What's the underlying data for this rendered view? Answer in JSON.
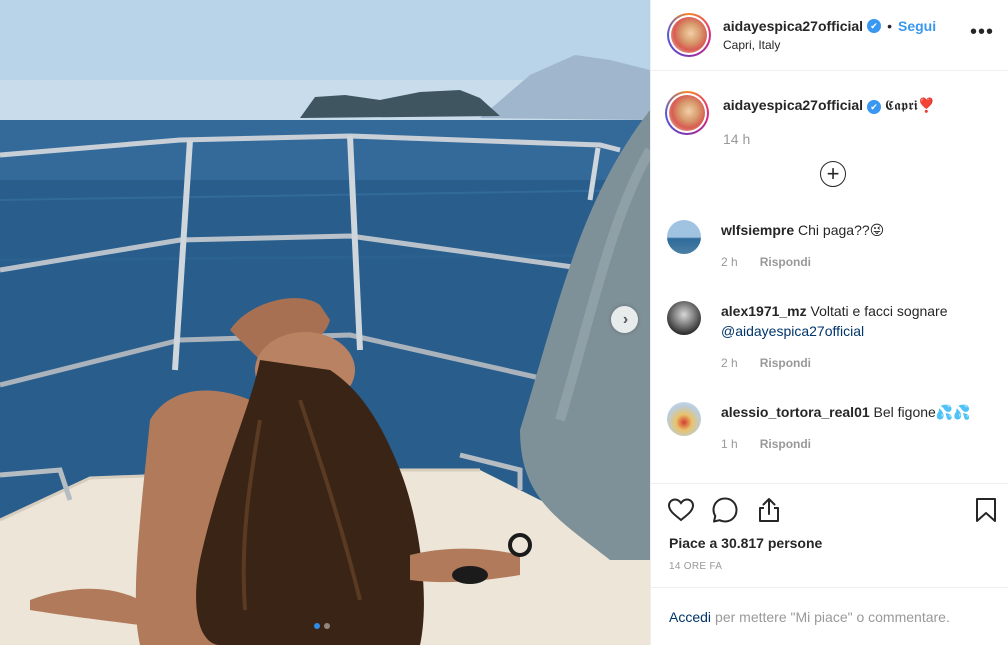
{
  "photo": {
    "alt": ""
  },
  "header": {
    "username": "aidayespica27official",
    "verified_mark": "✔",
    "separator": "•",
    "follow_label": "Segui",
    "location": "Capri, Italy",
    "more_label": "•••"
  },
  "caption": {
    "username": "aidayespica27official",
    "text": "𝕮𝖆𝖕𝖗𝖎❣️",
    "time": "14 h"
  },
  "load_more_label": "+",
  "comments": [
    {
      "username": "wlfsiempre",
      "text": "Chi paga??😜",
      "time": "2 h",
      "reply_label": "Rispondi"
    },
    {
      "username": "alex1971_mz",
      "text": "Voltati e facci sognare",
      "mention": "@aidayespica27official",
      "time": "2 h",
      "reply_label": "Rispondi"
    },
    {
      "username": "alessio_tortora_real01",
      "text": "Bel figone💦💦",
      "time": "1 h",
      "reply_label": "Rispondi"
    }
  ],
  "actions": {
    "icons": [
      "heart-icon",
      "comment-icon",
      "share-icon",
      "bookmark-icon"
    ],
    "likes_text": "Piace a 30.817 persone",
    "timestamp": "14 ORE FA"
  },
  "login": {
    "link_label": "Accedi",
    "rest_text": "per mettere \"Mi piace\" o commentare."
  },
  "colors": {
    "link": "#3897f0",
    "muted": "#999999",
    "text": "#262626"
  }
}
